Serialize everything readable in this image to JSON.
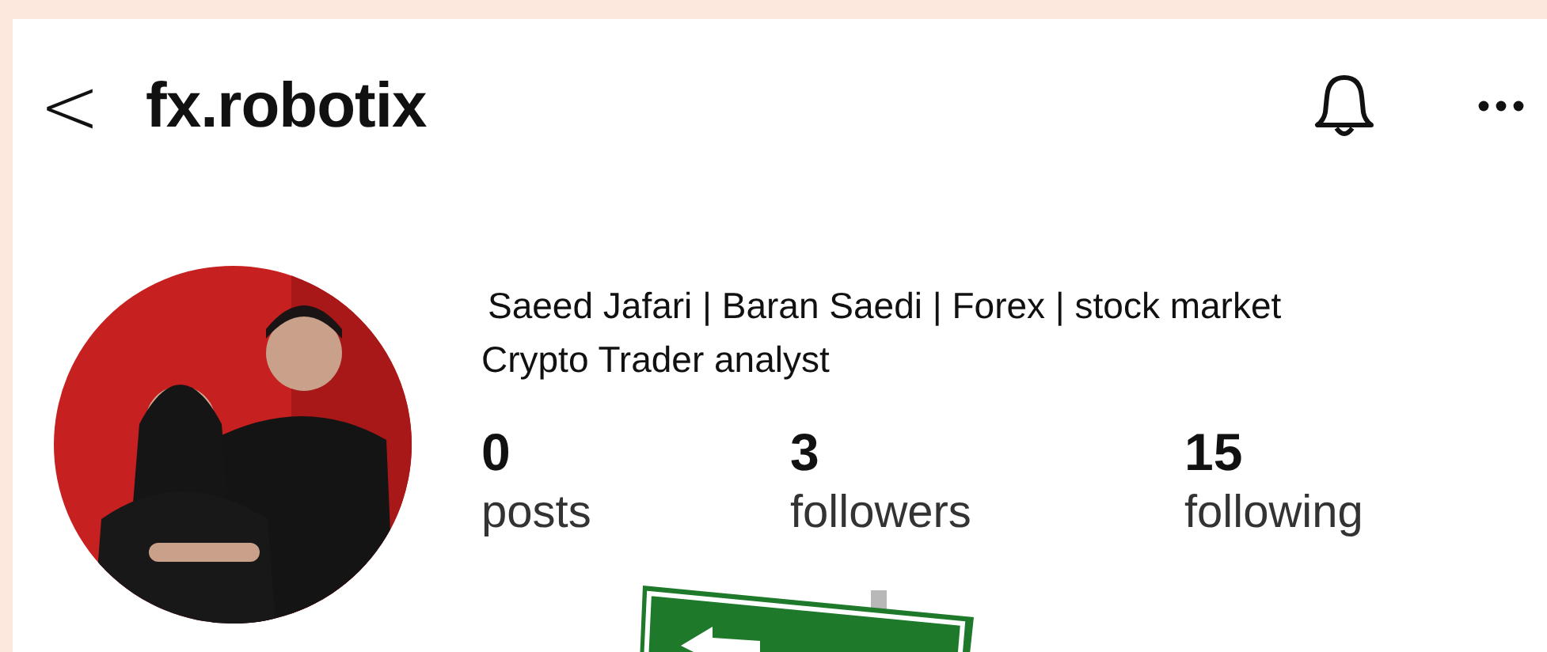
{
  "header": {
    "back": "<",
    "username": "fx.robotix"
  },
  "profile": {
    "avatar": {
      "kind": "picture"
    },
    "bio": [
      "Saeed Jafari | Baran Saedi | Forex | stock market",
      "Crypto Trader analyst"
    ],
    "stats": [
      {
        "value": "0",
        "label": "posts"
      },
      {
        "value": "3",
        "label": "followers"
      },
      {
        "value": "15",
        "label": "following"
      }
    ]
  },
  "overlay": {
    "kind": "picture"
  }
}
